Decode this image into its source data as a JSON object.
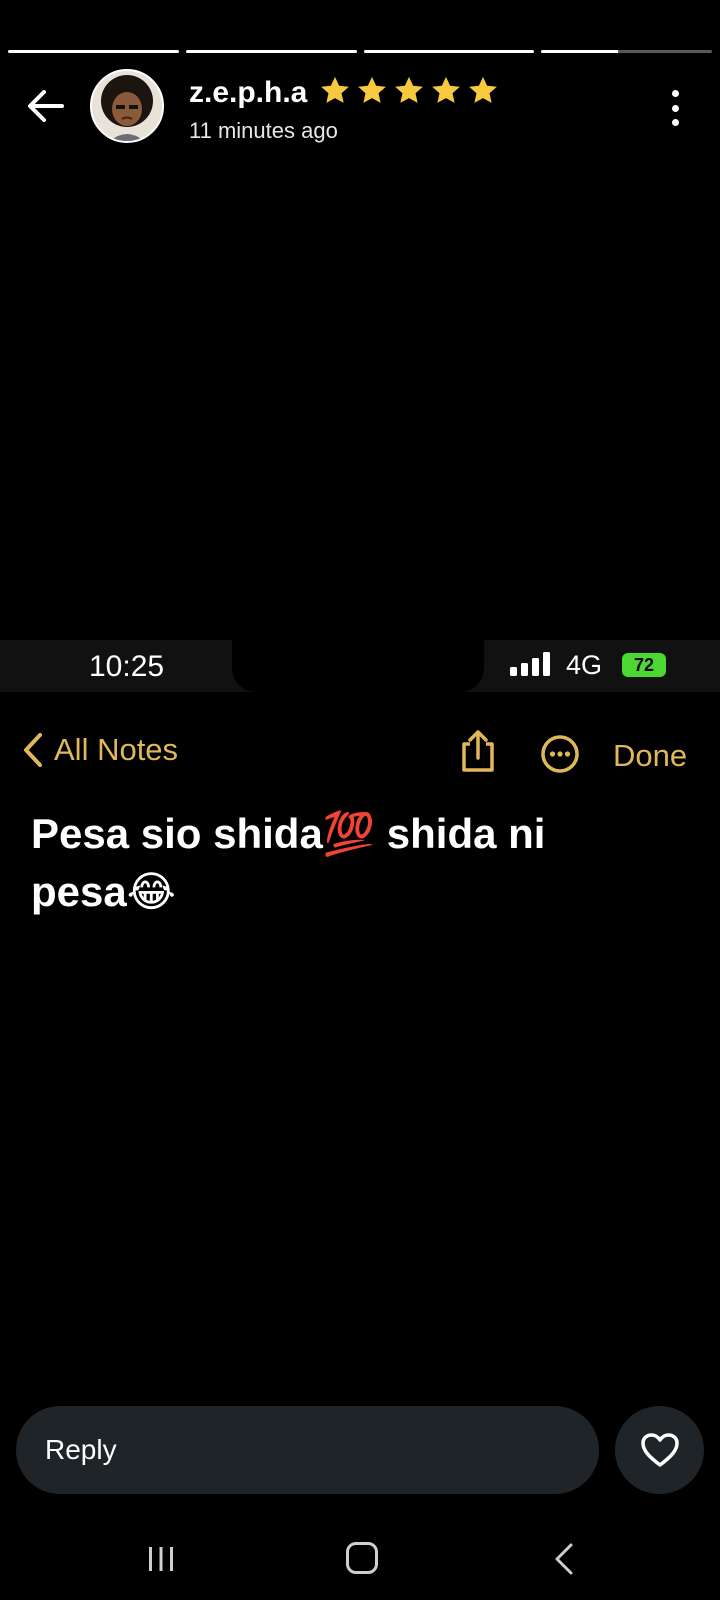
{
  "story": {
    "progress": [
      1,
      1,
      1,
      0.45
    ],
    "username": "z.e.p.h.a",
    "username_emoji": "⭐⭐⭐⭐⭐",
    "timestamp": "11 minutes ago",
    "icons": {
      "back": "arrow-left-icon",
      "menu": "more-vertical-icon"
    }
  },
  "inner_screenshot": {
    "status_time": "10:25",
    "network": "4G",
    "battery": "72",
    "notes_back_label": "All Notes",
    "done_label": "Done",
    "note_text": "Pesa sio shida💯 shida ni pesa😂",
    "accent_color": "#e0b85a",
    "icons": {
      "share": "share-icon",
      "more": "more-circle-icon"
    }
  },
  "reply": {
    "placeholder": "Reply",
    "like_icon": "heart-icon"
  },
  "system_nav": {
    "icons": [
      "recents-icon",
      "home-icon",
      "back-icon"
    ]
  }
}
